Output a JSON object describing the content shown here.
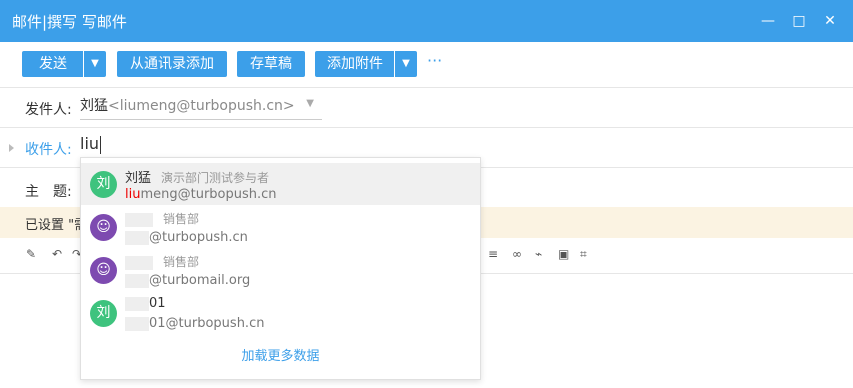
{
  "window": {
    "title": "邮件|撰写  写邮件",
    "minimize": "—",
    "maximize": "□",
    "close": "✕"
  },
  "toolbar": {
    "send": "发送",
    "from_contacts": "从通讯录添加",
    "save_draft": "存草稿",
    "add_attachment": "添加附件",
    "more": "···"
  },
  "form": {
    "sender_label": "发件人:",
    "sender_name": "刘猛",
    "sender_email": "<liumeng@turbopush.cn>",
    "recipient_label": "收件人:",
    "recipient_value": "liu",
    "subject_label": "主　题:"
  },
  "notice": {
    "text": "已设置 \"需"
  },
  "suggestions": [
    {
      "avatar_text": "刘",
      "name": "刘猛",
      "dept": "演示部门测试参与者",
      "email_highlight": "liu",
      "email_rest": "meng@turbopush.cn",
      "avatar_color": "#3ec37e"
    },
    {
      "avatar_text": "",
      "name": "",
      "dept": "销售部",
      "email_highlight": "",
      "email_rest": "@turbopush.cn",
      "avatar_color": "#7d4ab0"
    },
    {
      "avatar_text": "",
      "name": "",
      "dept": "销售部",
      "email_highlight": "",
      "email_rest": "@turbomail.org",
      "avatar_color": "#7d4ab0"
    },
    {
      "avatar_text": "刘",
      "name": "01",
      "dept": "",
      "email_highlight": "",
      "email_rest": "01@turbopush.cn",
      "avatar_color": "#3ec37e"
    }
  ],
  "load_more": "加载更多数据",
  "colors": {
    "accent": "#3c9fe9",
    "highlight_text": "#e00000",
    "notice_bg": "#fbf3e2"
  }
}
